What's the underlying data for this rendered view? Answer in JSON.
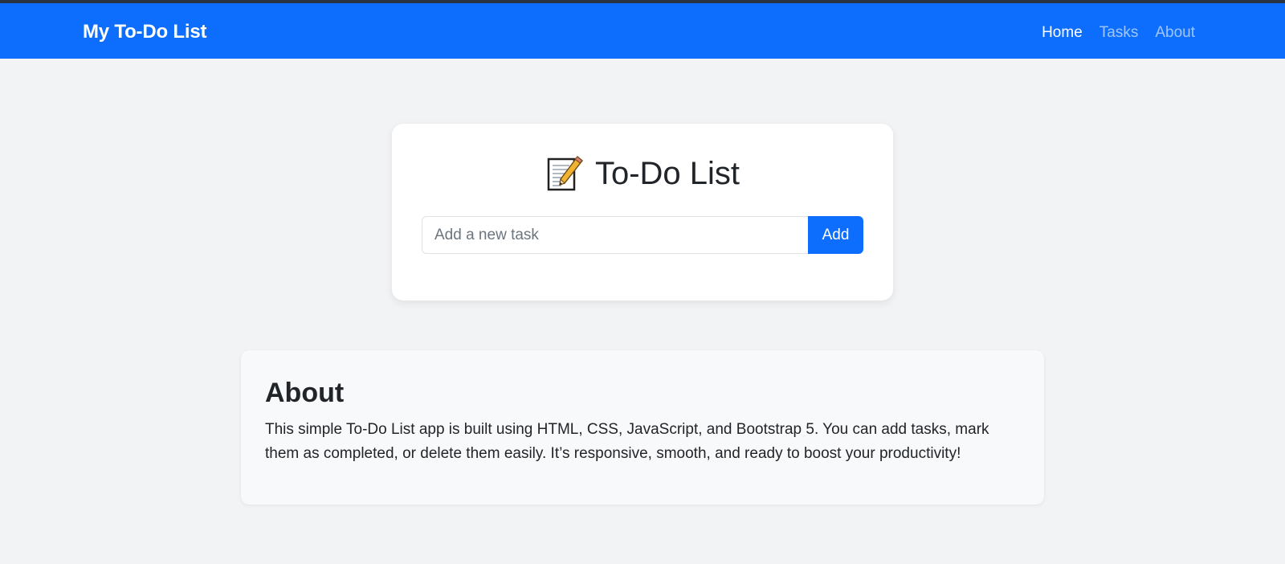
{
  "navbar": {
    "brand": "My To-Do List",
    "links": [
      {
        "label": "Home",
        "active": true
      },
      {
        "label": "Tasks",
        "active": false
      },
      {
        "label": "About",
        "active": false
      }
    ],
    "color": "#0d6efd"
  },
  "todo": {
    "icon": "memo-icon",
    "title": "To-Do List",
    "input": {
      "value": "",
      "placeholder": "Add a new task"
    },
    "add_label": "Add"
  },
  "about": {
    "heading": "About",
    "text": "This simple To-Do List app is built using HTML, CSS, JavaScript, and Bootstrap 5. You can add tasks, mark them as completed, or delete them easily. It’s responsive, smooth, and ready to boost your productivity!"
  }
}
